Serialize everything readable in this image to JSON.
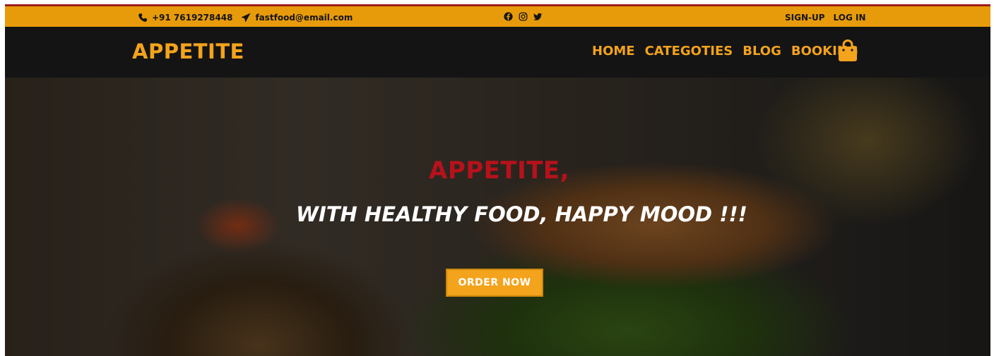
{
  "topbar": {
    "phone": "+91 7619278448",
    "email": "fastfood@email.com",
    "social_icons": [
      "facebook-icon",
      "instagram-icon",
      "twitter-icon"
    ],
    "signup_label": "SIGN-UP",
    "login_label": "LOG IN"
  },
  "navbar": {
    "logo": "APPETITE",
    "menu": [
      {
        "label": "HOME"
      },
      {
        "label": "CATEGOTIES"
      },
      {
        "label": "BLOG"
      },
      {
        "label": "BOOKING"
      }
    ],
    "cart_icon": "shopping-bag-icon"
  },
  "hero": {
    "title": "APPETITE,",
    "subtitle": "WITH HEALTHY FOOD, HAPPY MOOD !!!",
    "cta_label": "ORDER NOW"
  },
  "colors": {
    "topbar_bg": "#e89b0a",
    "top_border": "#9e1d1d",
    "navbar_bg": "#141414",
    "accent": "#f3a31c",
    "hero_title": "#b5121b"
  }
}
